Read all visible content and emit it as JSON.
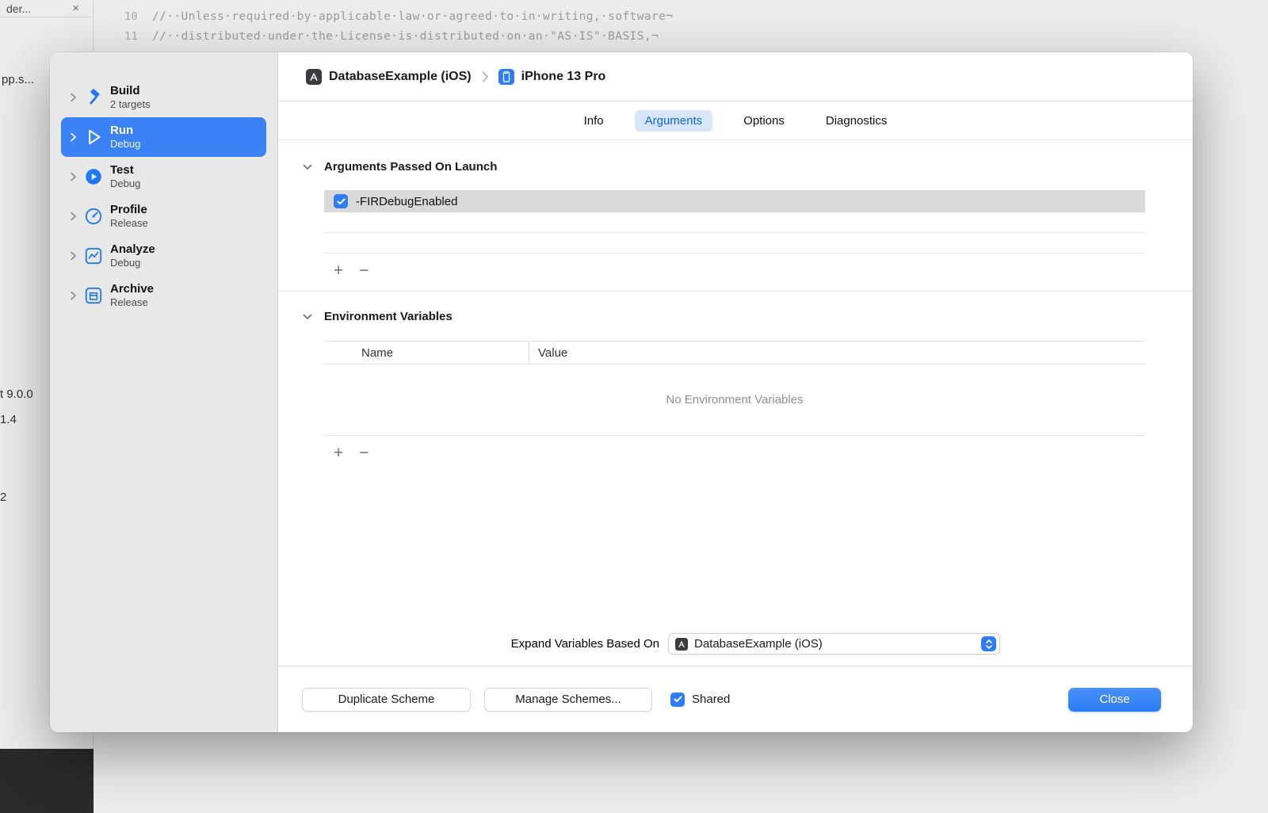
{
  "colors": {
    "accent_blue": "#2F7CF6",
    "sidebar_selected_bg": "#3B82F7",
    "tab_pill_bg": "#D7E6FB",
    "tab_pill_text": "#1065E9",
    "selected_row_bg": "#D9D9D9"
  },
  "background": {
    "tab_title": "der...",
    "tab_close": "×",
    "sidebar_partials": {
      "file": "pp.s...",
      "version_line1": "t 9.0.0",
      "version_line2": "1.4",
      "number": "2"
    },
    "code": {
      "lines": [
        {
          "num": "10",
          "text": "//··Unless·required·by·applicable·law·or·agreed·to·in·writing,·software¬"
        },
        {
          "num": "11",
          "text": "//··distributed·under·the·License·is·distributed·on·an·\"AS·IS\"·BASIS,¬"
        }
      ]
    }
  },
  "dialog": {
    "breadcrumb": {
      "scheme": "DatabaseExample (iOS)",
      "destination": "iPhone 13 Pro"
    },
    "tabs": [
      {
        "label": "Info",
        "selected": false
      },
      {
        "label": "Arguments",
        "selected": true
      },
      {
        "label": "Options",
        "selected": false
      },
      {
        "label": "Diagnostics",
        "selected": false
      }
    ],
    "sidebar": {
      "items": [
        {
          "title": "Build",
          "subtitle": "2 targets",
          "icon": "hammer-icon",
          "selected": false
        },
        {
          "title": "Run",
          "subtitle": "Debug",
          "icon": "play-icon",
          "selected": true
        },
        {
          "title": "Test",
          "subtitle": "Debug",
          "icon": "test-icon",
          "selected": false
        },
        {
          "title": "Profile",
          "subtitle": "Release",
          "icon": "profile-icon",
          "selected": false
        },
        {
          "title": "Analyze",
          "subtitle": "Debug",
          "icon": "analyze-icon",
          "selected": false
        },
        {
          "title": "Archive",
          "subtitle": "Release",
          "icon": "archive-icon",
          "selected": false
        }
      ]
    },
    "arguments": {
      "title": "Arguments Passed On Launch",
      "rows": [
        {
          "value": "-FIRDebugEnabled",
          "checked": true
        }
      ],
      "add": "+",
      "remove": "−"
    },
    "environment": {
      "title": "Environment Variables",
      "columns": {
        "name": "Name",
        "value": "Value"
      },
      "empty": "No Environment Variables",
      "add": "+",
      "remove": "−"
    },
    "expand": {
      "label": "Expand Variables Based On",
      "value": "DatabaseExample (iOS)"
    },
    "footer": {
      "duplicate": "Duplicate Scheme",
      "manage": "Manage Schemes...",
      "shared": "Shared",
      "shared_checked": true,
      "close": "Close"
    }
  }
}
